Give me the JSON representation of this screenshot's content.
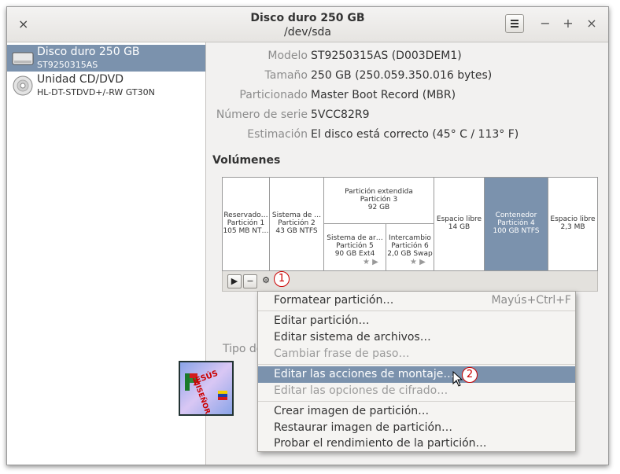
{
  "window": {
    "title": "Disco duro 250 GB",
    "subtitle": "/dev/sda",
    "close": "×",
    "minimize": "−",
    "maximize": "+",
    "window_close": "×"
  },
  "sidebar": {
    "items": [
      {
        "name": "Disco duro 250 GB",
        "model": "ST9250315AS",
        "icon": "hard-disk-icon",
        "selected": true
      },
      {
        "name": "Unidad CD/DVD",
        "model": "HL-DT-STDVD+/-RW GT30N",
        "icon": "optical-disc-icon",
        "selected": false
      }
    ]
  },
  "details": {
    "model_label": "Modelo",
    "model_value": "ST9250315AS (D003DEM1)",
    "size_label": "Tamaño",
    "size_value": "250 GB (250.059.350.016 bytes)",
    "partitioning_label": "Particionado",
    "partitioning_value": "Master Boot Record (MBR)",
    "serial_label": "Número de serie",
    "serial_value": "5VCC82R9",
    "assessment_label": "Estimación",
    "assessment_value": "El disco está correcto (45° C / 113° F)"
  },
  "volumes": {
    "heading": "Volúmenes",
    "segments": [
      {
        "l1": "Reservado…",
        "l2": "Partición 1",
        "l3": "105 MB NT…"
      },
      {
        "l1": "Sistema de …",
        "l2": "Partición 2",
        "l3": "43 GB NTFS"
      },
      {
        "l1": "Partición extendida",
        "l2": "Partición 3",
        "l3": "92 GB"
      },
      {
        "l1": "Sistema de ar…",
        "l2": "Partición 5",
        "l3": "90 GB Ext4"
      },
      {
        "l1": "Intercambio",
        "l2": "Partición 6",
        "l3": "2,0 GB Swap"
      },
      {
        "l1": "Espacio libre",
        "l2": "14 GB"
      },
      {
        "l1": "Contenedor",
        "l2": "Partición 4",
        "l3": "100 GB NTFS",
        "selected": true
      },
      {
        "l1": "Espacio libre",
        "l2": "2,3 MB"
      }
    ],
    "status_icons": "★ ▶"
  },
  "toolbar": {
    "play": "▶",
    "minus": "−",
    "gear": "⚙"
  },
  "callouts": [
    "1",
    "2"
  ],
  "obscured": {
    "partial_label": "Tipo de",
    "partial_d": "D"
  },
  "menu": {
    "items": [
      {
        "label": "Formatear partición…",
        "shortcut": "Mayús+Ctrl+F",
        "disabled": false
      },
      {
        "label": "Editar partición…",
        "disabled": false
      },
      {
        "label": "Editar sistema de archivos…",
        "disabled": false
      },
      {
        "label": "Cambiar frase de paso…",
        "disabled": true
      },
      {
        "label": "Editar las acciones de montaje…",
        "disabled": false,
        "highlighted": true
      },
      {
        "label": "Editar las opciones de cifrado…",
        "disabled": true
      },
      {
        "label": "Crear imagen de partición…",
        "disabled": false
      },
      {
        "label": "Restaurar imagen de partición…",
        "disabled": false
      },
      {
        "label": "Probar el rendimiento de la partición…",
        "disabled": false
      }
    ]
  },
  "watermark": {
    "text": "MISEÑOR JESÚS"
  }
}
